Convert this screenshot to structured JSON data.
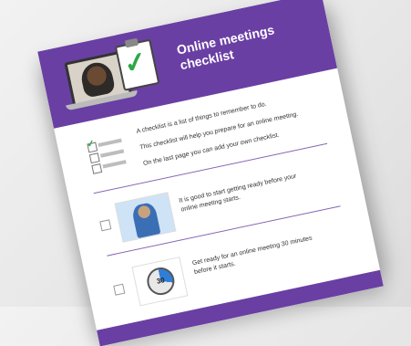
{
  "document": {
    "title_line1": "Online meetings",
    "title_line2": "checklist",
    "intro": [
      "A checklist is a list of things to remember to do.",
      "This checklist will help you prepare for an online meeting.",
      "On the last page you can add your own checklist."
    ],
    "items": [
      {
        "text_line1": "It is good to start getting ready before your",
        "text_line2": "online meeting starts."
      },
      {
        "text_line1": "Get ready for an online meeting 30 minutes",
        "text_line2": "before it starts.",
        "timer_label": "30"
      }
    ]
  },
  "colors": {
    "header": "#6a3fa3",
    "check": "#2ea84a",
    "background": "#e6e6e6"
  }
}
